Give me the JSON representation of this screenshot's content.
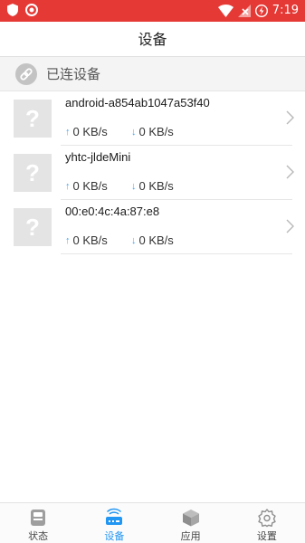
{
  "status_bar": {
    "time": "7:19",
    "left_icons": [
      "shield-icon",
      "target-icon"
    ],
    "right_icons": [
      "wifi-icon",
      "signal-off-icon",
      "battery-charging-icon"
    ],
    "background": "#e53935"
  },
  "header": {
    "title": "设备"
  },
  "section": {
    "title": "已连设备",
    "icon": "link-icon"
  },
  "devices": [
    {
      "name": "android-a854ab1047a53f40",
      "upload": "0 KB/s",
      "download": "0 KB/s"
    },
    {
      "name": "yhtc-jldeMini",
      "upload": "0 KB/s",
      "download": "0 KB/s"
    },
    {
      "name": "00:e0:4c:4a:87:e8",
      "upload": "0 KB/s",
      "download": "0 KB/s"
    }
  ],
  "device_placeholder": "?",
  "arrows": {
    "up": "↑",
    "down": "↓"
  },
  "bottom_nav": [
    {
      "label": "状态",
      "icon": "status-icon",
      "active": false
    },
    {
      "label": "设备",
      "icon": "router-icon",
      "active": true
    },
    {
      "label": "应用",
      "icon": "apps-box-icon",
      "active": false
    },
    {
      "label": "设置",
      "icon": "gear-icon",
      "active": false
    }
  ],
  "colors": {
    "accent": "#2196f3",
    "arrow": "#42a5f5"
  }
}
